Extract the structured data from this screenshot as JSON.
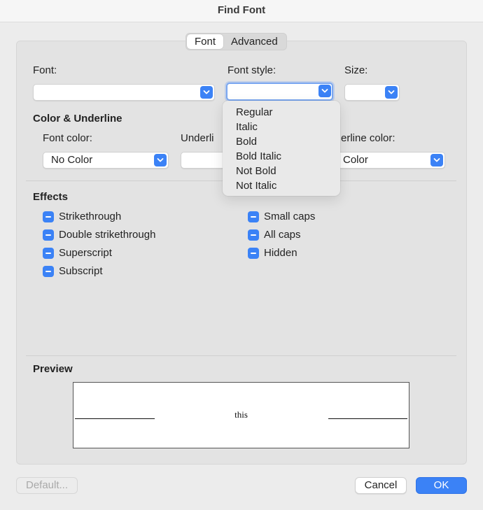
{
  "window": {
    "title": "Find Font"
  },
  "tabs": [
    {
      "label": "Font",
      "active": true
    },
    {
      "label": "Advanced",
      "active": false
    }
  ],
  "font_section": {
    "font_label": "Font:",
    "font_value": "",
    "style_label": "Font style:",
    "style_value": "",
    "size_label": "Size:",
    "size_value": ""
  },
  "style_menu": {
    "options": [
      "Regular",
      "Italic",
      "Bold",
      "Bold Italic",
      "Not Bold",
      "Not Italic"
    ]
  },
  "color_underline": {
    "heading": "Color & Underline",
    "font_color_label": "Font color:",
    "font_color_value": "No Color",
    "underline_label": "Underli",
    "underline_value": "",
    "underline_color_label": "erline color:",
    "underline_color_value": "Color"
  },
  "effects": {
    "heading": "Effects",
    "left": [
      "Strikethrough",
      "Double strikethrough",
      "Superscript",
      "Subscript"
    ],
    "right": [
      "Small caps",
      "All caps",
      "Hidden"
    ]
  },
  "preview": {
    "heading": "Preview",
    "sample_text": "this"
  },
  "buttons": {
    "default": "Default...",
    "cancel": "Cancel",
    "ok": "OK"
  },
  "colors": {
    "accent": "#3b82f6",
    "panel": "#e3e3e3",
    "window": "#ececec"
  }
}
